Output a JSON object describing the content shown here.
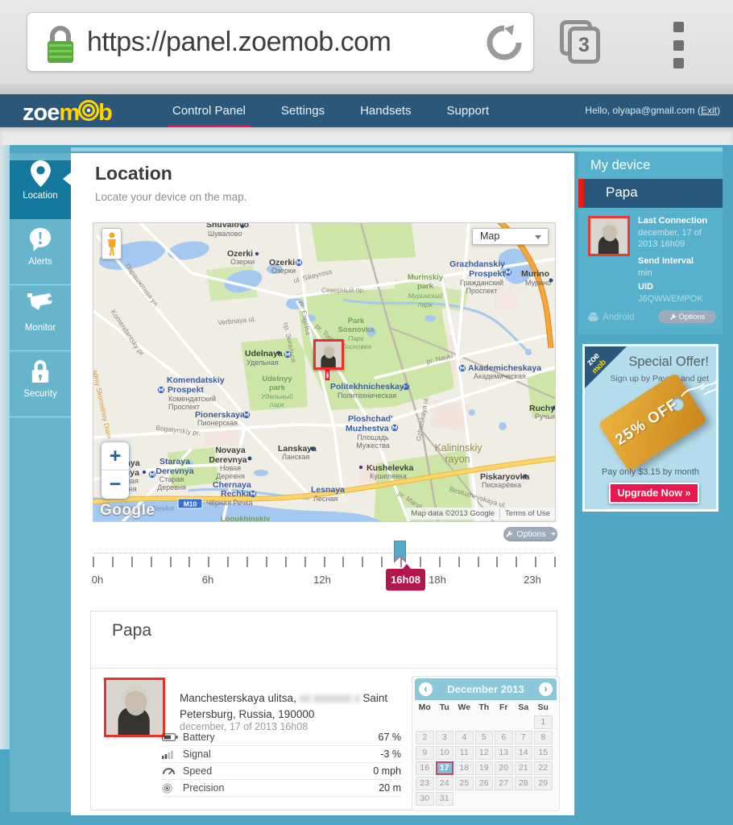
{
  "browser": {
    "url": "https://panel.zoemob.com",
    "tab_count": "3"
  },
  "nav": {
    "logo_zoe": "zoe",
    "logo_m": "m",
    "logo_b": "b",
    "items": [
      {
        "label": "Control Panel"
      },
      {
        "label": "Settings"
      },
      {
        "label": "Handsets"
      },
      {
        "label": "Support"
      }
    ],
    "greeting_prefix": "Hello, olyapa@gmail.com (",
    "exit_label": "Exit",
    "greeting_suffix": ")"
  },
  "sidebar": {
    "items": [
      {
        "label": "Location"
      },
      {
        "label": "Alerts"
      },
      {
        "label": "Monitor"
      },
      {
        "label": "Security"
      }
    ]
  },
  "main": {
    "title": "Location",
    "subtitle": "Locate your device on the map."
  },
  "map": {
    "type_label": "Map",
    "zoom_in": "+",
    "zoom_out": "−",
    "google": "Google",
    "attribution": "Map data ©2013 Google",
    "terms": "Terms of Use",
    "labels": {
      "shuvalovo": "Shuvalovo",
      "shuvalovo_ru": "Шувалово",
      "ozerki1": "Ozerki",
      "ozerki1_ru": "Озерки",
      "ozerki2": "Ozerki",
      "ozerki2_ru": "Озерки",
      "sikeyrosa": "ul. Sikeyrosa",
      "grazhdanskiy1": "Grazhdanskiy",
      "grazhdanskiy2": "Prospekt",
      "grazhdanskiy_ru1": "Гражданский",
      "grazhdanskiy_ru2": "Проспект",
      "murino": "Murino",
      "murino_ru": "Мурино",
      "murinskiy1": "Murinskiy",
      "murinskiy2": "park",
      "murinskiy_ru1": "Муринский",
      "murinskiy_ru2": "парк",
      "severny": "Северный пр.",
      "sosnovka1": "Park",
      "sosnovka2": "Sosnovka",
      "sosnovka_ru1": "Парк",
      "sosnovka_ru2": "Сосновка",
      "parashyutnaya": "Парашютная ул.",
      "komendantsky_pr": "Komendantsky pr.",
      "skorostnoy": "adniy Skorostnoy Diam",
      "verbnaya": "Verbnaya ul.",
      "udelnaya": "Udelnaya",
      "udelnaya_ru": "Удельная",
      "udelnyy1": "Udelnyy",
      "udelnyy2": "park",
      "udelnyy_ru1": "Удельный",
      "udelnyy_ru2": "парк",
      "komendatskiy1": "Komendatskiy",
      "komendatskiy2": "Prospekt",
      "komendatskiy_ru1": "Комендатский",
      "komendatskiy_ru2": "Проспект",
      "politekhnicheskaya": "Politekhnicheskaya",
      "politekhnicheskaya_ru": "Политехническая",
      "pionerskaya": "Pionerskaya",
      "pionerskaya_ru": "Пионерская",
      "bogatyrskiy": "Bogatyrskiy pr.",
      "ploshchad1": "Ploshchad'",
      "ploshchad2": "Muzhestva",
      "ploshchad_ru1": "Площадь",
      "ploshchad_ru2": "Мужества",
      "engelsa": "pr. Engelsa",
      "engelsa_ru": "пр. Энгельса",
      "toreza": "pr. Toreza",
      "nauki": "pr. Nauki",
      "akademicheskaya": "Akademicheskaya",
      "akademicheskaya_ru": "Академическая",
      "lanskaya": "Lanskaya",
      "lanskaya_ru": "Ланская",
      "kushelevka": "Kushelevka",
      "kushelevka_ru": "Кушелевка",
      "novaya1": "Novaya",
      "novaya2": "Derevnya",
      "novaya_ru1": "Новая",
      "novaya_ru2": "Деревня",
      "staraya1": "Staraya",
      "staraya2": "Derevnya",
      "staraya_ru1": "Старая",
      "staraya_ru2": "Деревня",
      "staraya_cut1": "raya",
      "staraya_cut2": "vnya",
      "staraya_cut_ru1": "арая",
      "staraya_cut_ru2": "евня",
      "chernaya": "Chernaya",
      "rechka": "Rechka",
      "chernaya_ru": "Чёрная Речка",
      "lesnaya": "Lesnaya",
      "lesnaya_ru": "Лесная",
      "m10": "M10",
      "nevka": "Bolshaya Nevka",
      "lopukhinskiy": "Lopukhinskiy",
      "ruchyi": "Ruchyi",
      "ruchyi_ru": "Ручьи",
      "kalininskiy1": "Kalininskiy",
      "kalininskiy2": "rayon",
      "piskaryovka": "Piskaryovka",
      "piskaryovka_ru": "Пискарёвка",
      "bestuzhevskaya": "Bestuzhevskaya ul.",
      "gzhatskaya": "Gzhatskaya ul.",
      "marshala": "pr. Marshala"
    }
  },
  "timeline": {
    "options_label": "Options",
    "labels": {
      "h0": "0h",
      "h6": "6h",
      "h12": "12h",
      "h18": "18h",
      "h23": "23h"
    },
    "selected": "16h08"
  },
  "device_panel": {
    "header": "My device",
    "name": "Papa",
    "last_connection_label": "Last Connection",
    "last_connection_line1": "december, 17 of",
    "last_connection_line2": "2013 16h09",
    "send_interval_label": "Send Interval",
    "send_interval_value": "min",
    "uid_label": "UID",
    "uid_value": "J6QWWEMPOK",
    "platform": "Android",
    "options_label": "Options"
  },
  "offer": {
    "ribbon_zoe": "zoe",
    "ribbon_mob": "mob",
    "title": "Special Offer!",
    "subtitle": "Sign up by Paypal and get",
    "tag": "25% OFF",
    "price": "Pay only $3.15 by month",
    "cta": "Upgrade Now »"
  },
  "detail": {
    "name": "Papa",
    "address_1": "Manchesterskaya ulitsa,",
    "address_blurred": "xx xxxxxxx x",
    "address_2": "Saint Petersburg, Russia, 190000",
    "timestamp": "december, 17 of 2013 16h08",
    "stats": [
      {
        "label": "Battery",
        "value": "67 %"
      },
      {
        "label": "Signal",
        "value": "-3 %"
      },
      {
        "label": "Speed",
        "value": "0 mph"
      },
      {
        "label": "Precision",
        "value": "20 m"
      }
    ]
  },
  "calendar": {
    "title": "December 2013",
    "days": [
      "Mo",
      "Tu",
      "We",
      "Th",
      "Fr",
      "Sa",
      "Su"
    ],
    "weeks": [
      [
        "",
        "",
        "",
        "",
        "",
        "",
        "1"
      ],
      [
        "2",
        "3",
        "4",
        "5",
        "6",
        "7",
        "8"
      ],
      [
        "9",
        "10",
        "11",
        "12",
        "13",
        "14",
        "15"
      ],
      [
        "16",
        "17",
        "18",
        "19",
        "20",
        "21",
        "22"
      ],
      [
        "23",
        "24",
        "25",
        "26",
        "27",
        "28",
        "29"
      ],
      [
        "30",
        "31",
        "",
        "",
        "",
        "",
        ""
      ]
    ],
    "selected": "17"
  }
}
